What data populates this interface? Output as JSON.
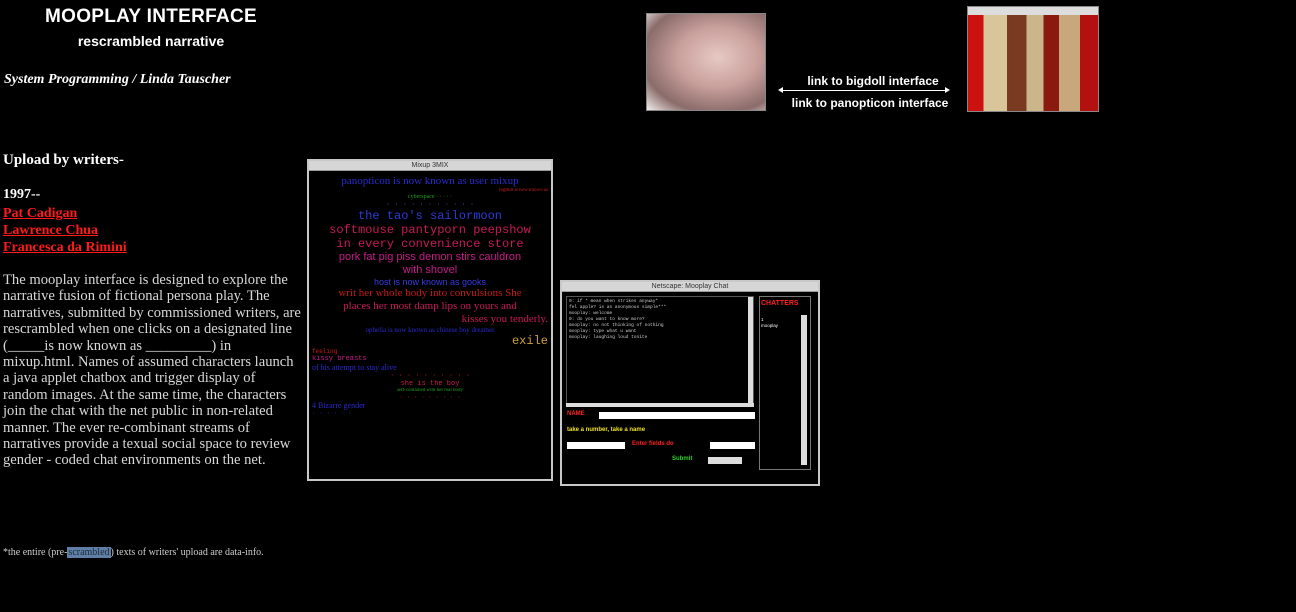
{
  "header": {
    "title": "MOOPLAY INTERFACE",
    "subtitle": "rescrambled narrative",
    "credit": "System Programming / Linda Tauscher"
  },
  "left": {
    "upload_heading": "Upload by writers-",
    "year": "1997--",
    "writers": [
      "Pat Cadigan",
      "Lawrence Chua",
      "Francesca da Rimini"
    ],
    "description": "The mooplay interface is designed to explore the narrative fusion of fictional persona play. The narratives, submitted by commissioned writers, are rescrambled when one clicks on a designated line (_____is now known as _________) in mixup.html. Names of assumed characters launch a java applet chatbox and trigger display of random images. At the same time, the characters join the chat with the net public in non-related manner. The ever re-combinant streams of narratives provide a texual social space to review gender - coded chat environments on the net.",
    "footnote_pre": "*the entire (pre-",
    "footnote_hl": "scrambled",
    "footnote_post": ") texts of writers' upload are data-info."
  },
  "nav": {
    "bigdoll_link": "link to bigdoll interface",
    "panopticon_link": "link to panopticon interface"
  },
  "mixup_window": {
    "title": "Mixup 3MIX",
    "lines": [
      {
        "text": "panopticon is now known as user mixup",
        "color": "#2b2bd0",
        "size": 11,
        "font": "\"Liberation Serif\", serif"
      },
      {
        "text": "bigdoll is now known as",
        "color": "#d01a1a",
        "size": 5,
        "font": "\"Liberation Serif\", serif",
        "align": "right"
      },
      {
        "text": "cyberspace  ·  ·  ·  ·  ·",
        "color": "#22a022",
        "size": 6,
        "font": "\"Liberation Serif\", serif"
      },
      {
        "text": "· · · · · · · · · · ·",
        "color": "#4a4ac0",
        "size": 7,
        "font": "\"Liberation Mono\", monospace"
      },
      {
        "text": "the tao's sailormoon",
        "color": "#2b3bd8",
        "size": 12,
        "font": "\"Liberation Mono\", monospace"
      },
      {
        "text": "softmouse pantyporn peepshow",
        "color": "#c81a5a",
        "size": 12,
        "font": "\"Liberation Mono\", monospace"
      },
      {
        "text": "in every convenience store",
        "color": "#c81a5a",
        "size": 12,
        "font": "\"Liberation Mono\", monospace"
      },
      {
        "text": "pork fat pig piss demon stirs cauldron",
        "color": "#c81a8a",
        "size": 11,
        "font": "\"Liberation Sans\", sans-serif"
      },
      {
        "text": "with shovel",
        "color": "#c81a8a",
        "size": 11,
        "font": "\"Liberation Sans\", sans-serif"
      },
      {
        "text": "host is now known as gooks",
        "color": "#3a3ae0",
        "size": 9,
        "font": "\"Liberation Sans\", sans-serif"
      },
      {
        "text": "writ her whole body into convulsions She",
        "color": "#c81a1a",
        "size": 11,
        "font": "\"Liberation Serif\", serif"
      },
      {
        "text": "places her most damp lips on yours and",
        "color": "#c81a5a",
        "size": 11,
        "font": "\"Liberation Serif\", serif"
      },
      {
        "text": "kisses you tenderly.",
        "color": "#c81a5a",
        "size": 11,
        "font": "\"Liberation Serif\", serif",
        "align": "right"
      },
      {
        "text": "ophelia is now known as chinese boy dreamer",
        "color": "#2b2bd0",
        "size": 7,
        "font": "\"Liberation Serif\", serif"
      },
      {
        "text": "exile",
        "color": "#d0a030",
        "size": 12,
        "font": "\"Liberation Mono\", monospace",
        "align": "right"
      },
      {
        "text": "feeling",
        "color": "#d01a1a",
        "size": 6,
        "font": "\"Liberation Mono\", monospace",
        "align": "left"
      },
      {
        "text": "kissy breasts",
        "color": "#c81a8a",
        "size": 7,
        "font": "\"Liberation Mono\", monospace",
        "align": "left"
      },
      {
        "text": "of his attempt to stay alive",
        "color": "#2b2bd0",
        "size": 8,
        "font": "\"Liberation Serif\", serif",
        "align": "left"
      },
      {
        "text": "· · · · · · · · · ·",
        "color": "#c81a1a",
        "size": 7,
        "font": "\"Liberation Mono\", monospace"
      },
      {
        "text": "she is the boy",
        "color": "#c81a5a",
        "size": 7,
        "font": "\"Liberation Mono\", monospace"
      },
      {
        "text": "self-contained with her real body",
        "color": "#22a022",
        "size": 5,
        "font": "\"Liberation Serif\", serif"
      },
      {
        "text": "· · · · · · · · ·",
        "color": "#c81a1a",
        "size": 6,
        "font": "\"Liberation Mono\", monospace"
      },
      {
        "text": "4 Bizarre gender",
        "color": "#2b2bd0",
        "size": 8,
        "font": "\"Liberation Serif\", serif",
        "align": "left"
      },
      {
        "text": "· · · · · ·",
        "color": "#2b2bd0",
        "size": 6,
        "font": "\"Liberation Mono\", monospace",
        "align": "left"
      }
    ]
  },
  "chat_window": {
    "title": "Netscape: Mooplay Chat",
    "users_label": "CHATTERS",
    "users": [
      "1",
      "mooplay"
    ],
    "log": [
      "0: if * mean when strikes anyway*",
      "fel apple? is an anonymous simple***",
      "mooplay: welcome",
      "0: do you want to know more?",
      "mooplay: no not thinking of nothing",
      "mooplay: type what u want",
      "mooplay: laughing loud tonite"
    ],
    "name_label": "NAME",
    "prompt": "take a number, take a name",
    "field_label": "Enter fields do",
    "submit_label": "Submit",
    "colors": {
      "red": "#ff2020",
      "yellow": "#f0e020",
      "green": "#30d030"
    }
  }
}
